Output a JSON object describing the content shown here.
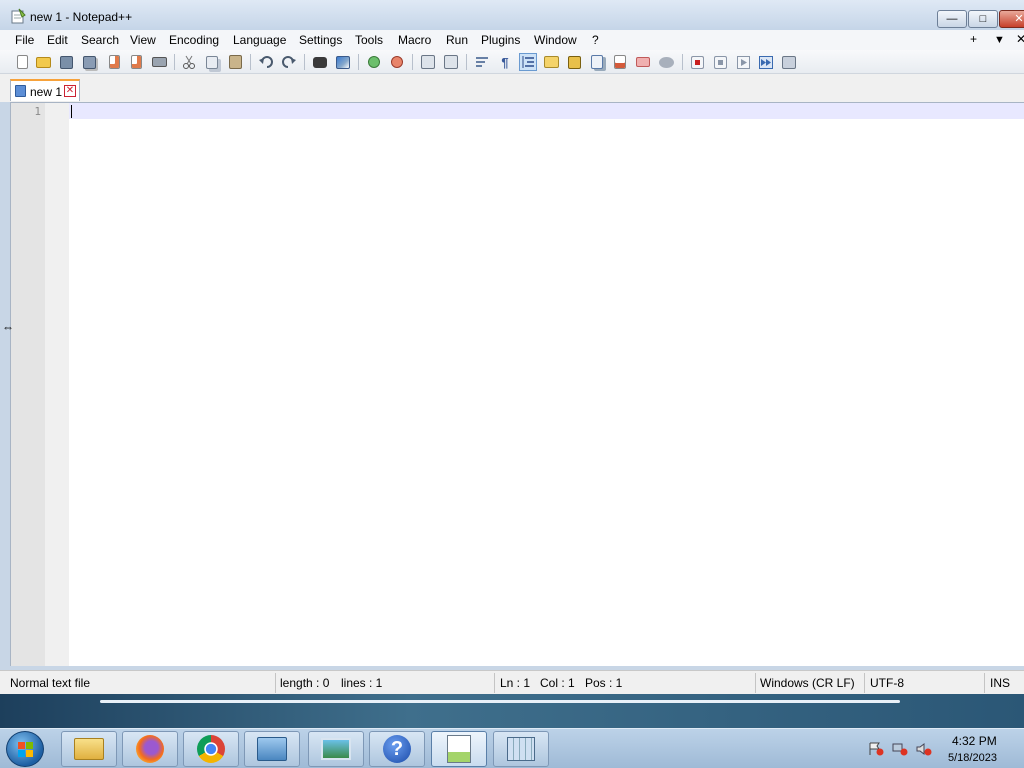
{
  "window": {
    "title": "new 1 - Notepad++",
    "minimize_glyph": "—",
    "maximize_glyph": "□",
    "close_glyph": "✕"
  },
  "menu": {
    "items": [
      "File",
      "Edit",
      "Search",
      "View",
      "Encoding",
      "Language",
      "Settings",
      "Tools",
      "Macro",
      "Run",
      "Plugins",
      "Window",
      "?"
    ],
    "right_plus": "+",
    "right_down": "▼",
    "right_close": "✕"
  },
  "toolbar": {
    "icons": [
      "new-file-icon",
      "open-file-icon",
      "save-icon",
      "save-all-icon",
      "close-icon",
      "close-all-icon",
      "print-icon",
      "cut-icon",
      "copy-icon",
      "paste-icon",
      "undo-icon",
      "redo-icon",
      "find-icon",
      "replace-icon",
      "zoom-in-icon",
      "zoom-out-icon",
      "sync-vertical-icon",
      "sync-horizontal-icon",
      "word-wrap-icon",
      "show-all-chars-icon",
      "indent-guide-icon",
      "user-language-icon",
      "document-map-icon",
      "function-list-icon",
      "folder-workspace-icon",
      "monitoring-icon",
      "record-macro-icon",
      "stop-record-icon",
      "play-macro-icon",
      "run-macro-multiple-icon",
      "save-macro-icon"
    ]
  },
  "tabs": [
    {
      "label": "new 1",
      "close": "✕"
    }
  ],
  "editor": {
    "line_numbers": [
      "1"
    ]
  },
  "status": {
    "file_type": "Normal text file",
    "length": "length : 0",
    "lines": "lines : 1",
    "ln": "Ln : 1",
    "col": "Col : 1",
    "pos": "Pos : 1",
    "eol": "Windows (CR LF)",
    "encoding": "UTF-8",
    "mode": "INS"
  },
  "taskbar": {
    "apps": [
      "file-explorer",
      "firefox",
      "chrome",
      "control-panel",
      "photo-viewer",
      "help",
      "notepad-plus-plus",
      "task-scheduler"
    ],
    "clock_time": "4:32 PM",
    "clock_date": "5/18/2023"
  },
  "colors": {
    "tab_accent": "#f7a23b",
    "current_line": "#e8e8ff",
    "close_red": "#c7402a"
  }
}
